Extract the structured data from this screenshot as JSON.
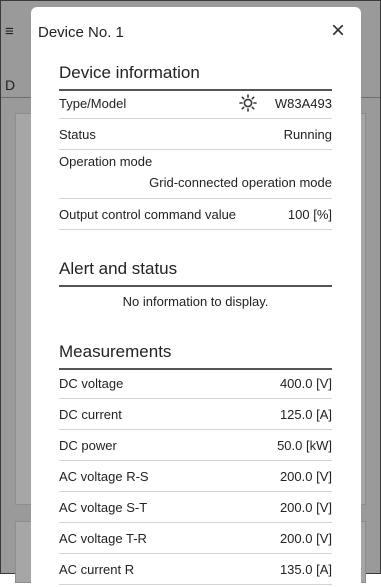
{
  "background": {
    "menu_glyph": "≡",
    "partial_letter": "D"
  },
  "dialog": {
    "title": "Device No. 1",
    "close_label": "×"
  },
  "device_information": {
    "heading": "Device information",
    "rows": [
      {
        "label": "Type/Model",
        "value": "W83A493",
        "icon": "settings-sun-icon"
      },
      {
        "label": "Status",
        "value": "Running"
      },
      {
        "label": "Operation mode",
        "value": "Grid-connected operation mode"
      },
      {
        "label": "Output control command value",
        "value": "100 [%]"
      }
    ]
  },
  "alert_status": {
    "heading": "Alert and status",
    "message": "No information to display."
  },
  "measurements": {
    "heading": "Measurements",
    "rows": [
      {
        "label": "DC voltage",
        "value": "400.0 [V]"
      },
      {
        "label": "DC current",
        "value": "125.0 [A]"
      },
      {
        "label": "DC power",
        "value": "50.0 [kW]"
      },
      {
        "label": "AC voltage R-S",
        "value": "200.0 [V]"
      },
      {
        "label": "AC voltage S-T",
        "value": "200.0 [V]"
      },
      {
        "label": "AC voltage T-R",
        "value": "200.0 [V]"
      },
      {
        "label": "AC current R",
        "value": "135.0 [A]"
      }
    ]
  }
}
